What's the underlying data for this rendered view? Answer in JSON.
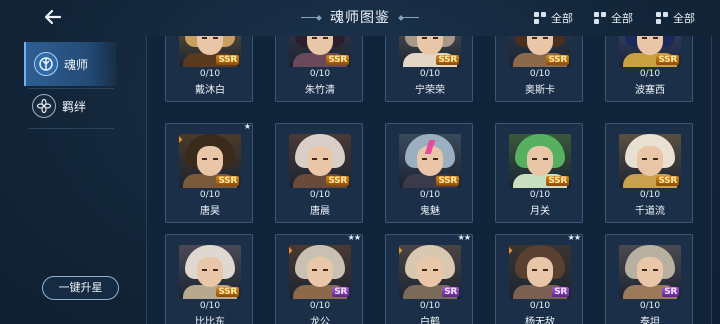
{
  "header": {
    "title": "魂师图鉴"
  },
  "filters": [
    {
      "label": "全部"
    },
    {
      "label": "全部"
    },
    {
      "label": "全部"
    }
  ],
  "sidebar": {
    "items": [
      {
        "label": "魂师",
        "active": true,
        "icon": "soul-master-icon"
      },
      {
        "label": "羁绊",
        "active": false,
        "icon": "bond-flower-icon"
      }
    ],
    "upgrade_button": "一键升星"
  },
  "colors": {
    "accent": "#6fb2f2",
    "ssr": "#d88a1a",
    "sr": "#a45ad8",
    "background": "#14263a"
  },
  "cards": [
    {
      "name": "戴沐白",
      "count": "0/10",
      "rarity": "SSR",
      "stars": ""
    },
    {
      "name": "朱竹清",
      "count": "0/10",
      "rarity": "SSR",
      "stars": ""
    },
    {
      "name": "宁荣荣",
      "count": "0/10",
      "rarity": "SSR",
      "stars": ""
    },
    {
      "name": "奥斯卡",
      "count": "0/10",
      "rarity": "SSR",
      "stars": ""
    },
    {
      "name": "波塞西",
      "count": "0/10",
      "rarity": "SSR",
      "stars": ""
    },
    {
      "name": "唐昊",
      "count": "0/10",
      "rarity": "SSR",
      "stars": "★"
    },
    {
      "name": "唐晨",
      "count": "0/10",
      "rarity": "SSR",
      "stars": ""
    },
    {
      "name": "鬼魅",
      "count": "0/10",
      "rarity": "SSR",
      "stars": ""
    },
    {
      "name": "月关",
      "count": "0/10",
      "rarity": "SSR",
      "stars": ""
    },
    {
      "name": "千道流",
      "count": "0/10",
      "rarity": "SSR",
      "stars": ""
    },
    {
      "name": "比比东",
      "count": "0/10",
      "rarity": "SSR",
      "stars": ""
    },
    {
      "name": "龙公",
      "count": "0/10",
      "rarity": "SR",
      "stars": "★★"
    },
    {
      "name": "白鹤",
      "count": "0/10",
      "rarity": "SR",
      "stars": "★★"
    },
    {
      "name": "杨无敌",
      "count": "0/10",
      "rarity": "SR",
      "stars": "★★"
    },
    {
      "name": "泰坦",
      "count": "0/10",
      "rarity": "SR",
      "stars": ""
    }
  ]
}
